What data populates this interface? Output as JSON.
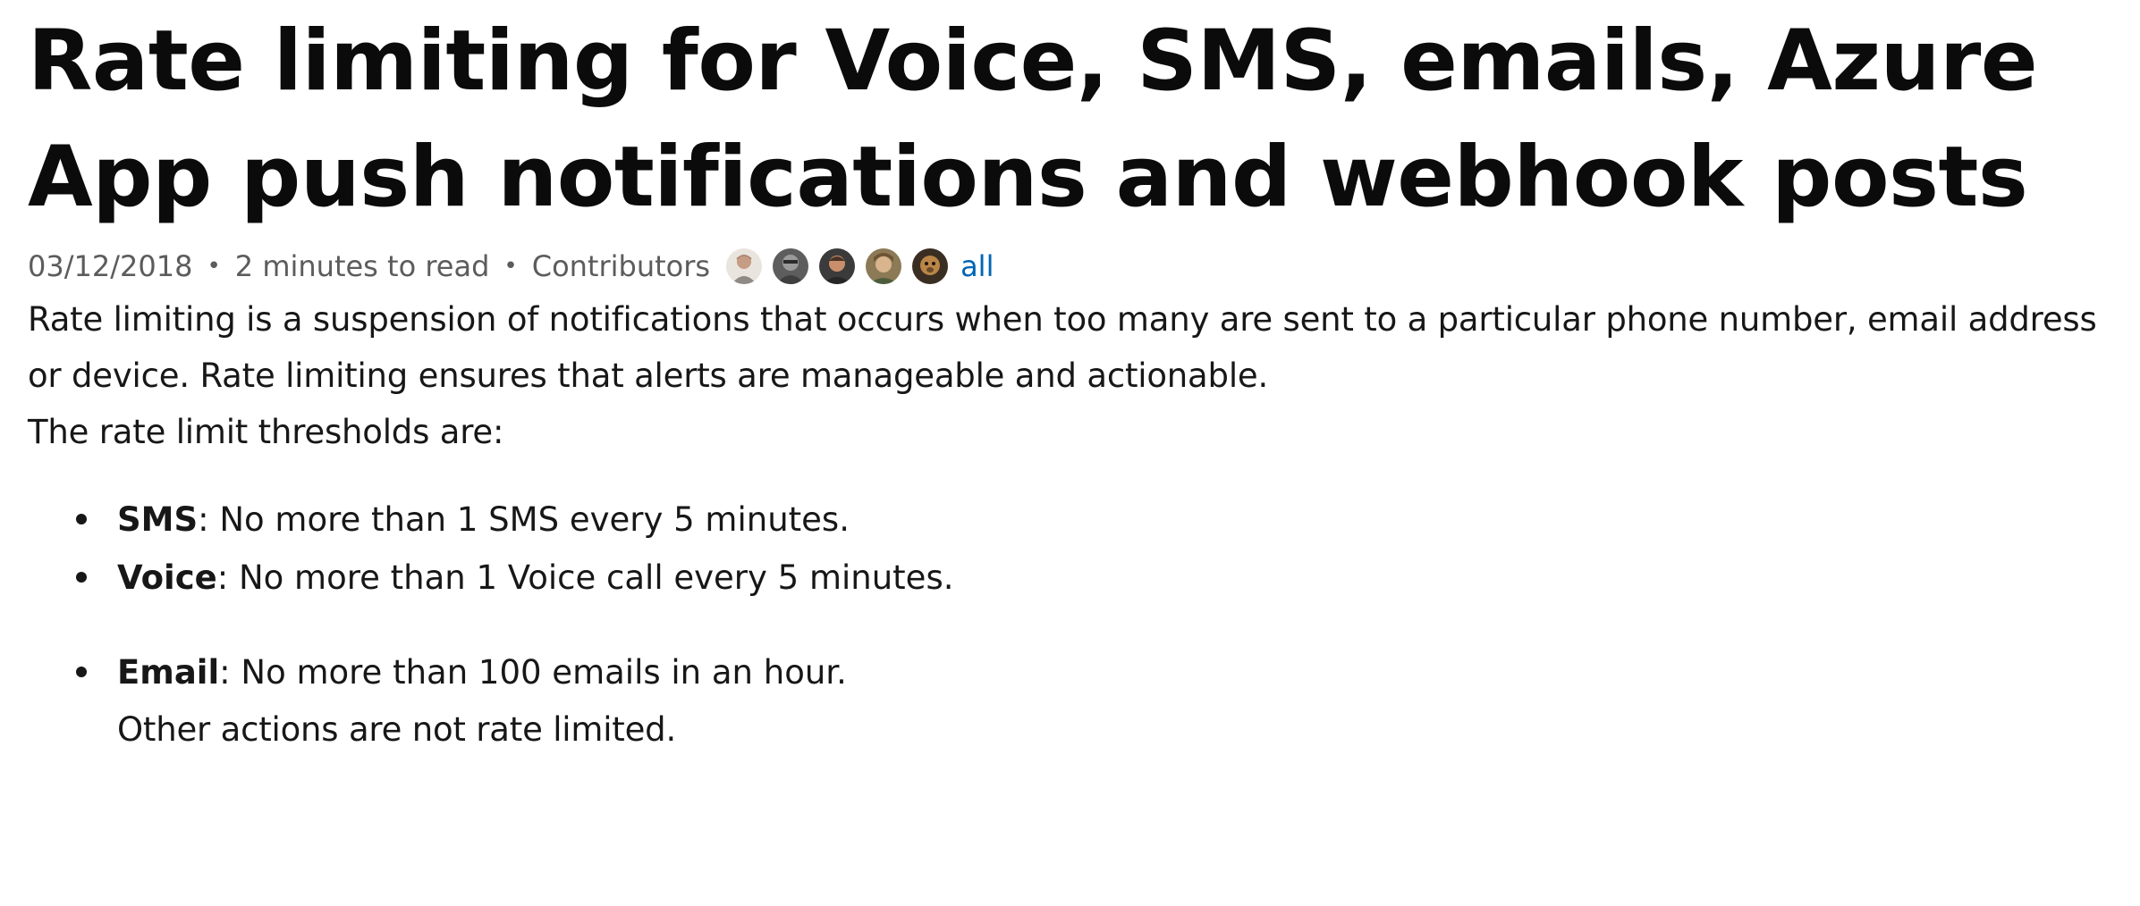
{
  "article": {
    "title": "Rate limiting for Voice, SMS, emails, Azure App push notifications and webhook posts",
    "metadata": {
      "date": "03/12/2018",
      "read_time": "2 minutes to read",
      "contributors_label": "Contributors",
      "all_link": "all",
      "separator": "•"
    },
    "intro": "Rate limiting is a suspension of notifications that occurs when too many are sent to a particular phone number, email address or device. Rate limiting ensures that alerts are manageable and actionable.",
    "thresholds_intro": "The rate limit thresholds are:",
    "limits": [
      {
        "term": "SMS",
        "text": ": No more than 1 SMS every 5 minutes."
      },
      {
        "term": "Voice",
        "text": ": No more than 1 Voice call every 5 minutes."
      },
      {
        "term": "Email",
        "text": ": No more than 100 emails in an hour."
      }
    ],
    "note": "Other actions are not rate limited."
  },
  "colors": {
    "text": "#171717",
    "metadata": "#5c5c5c",
    "link": "#0065b3"
  },
  "icons": {
    "contributor_avatars": [
      "avatar-photo-1",
      "avatar-photo-2",
      "avatar-photo-3",
      "avatar-photo-4",
      "avatar-photo-5"
    ]
  }
}
